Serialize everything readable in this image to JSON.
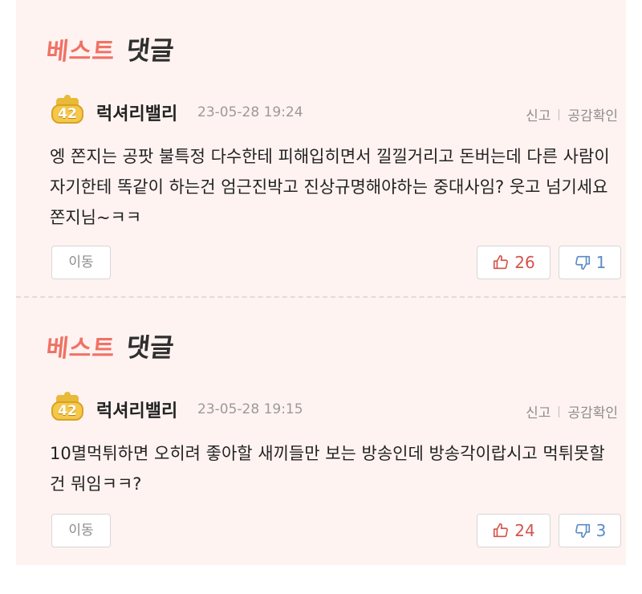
{
  "comments": [
    {
      "badge_red": "베스트",
      "badge_dark": "댓글",
      "level": "42",
      "username": "럭셔리밸리",
      "date": "23-05-28 19:24",
      "report": "신고",
      "agree_check": "공감확인",
      "text": "엥 쫀지는 공팟 불특정 다수한테 피해입히면서 낄낄거리고 돈버는데 다른 사람이 자기한테 똑같이 하는건 엄근진박고 진상규명해야하는 중대사임? 웃고 넘기세요 쫀지님~ㅋㅋ",
      "move_label": "이동",
      "likes": "26",
      "dislikes": "1"
    },
    {
      "badge_red": "베스트",
      "badge_dark": "댓글",
      "level": "42",
      "username": "럭셔리밸리",
      "date": "23-05-28 19:15",
      "report": "신고",
      "agree_check": "공감확인",
      "text": "10멸먹튀하면 오히려 좋아할 새끼들만 보는 방송인데 방송각이랍시고 먹튀못할건 뭐임ㅋㅋ?",
      "move_label": "이동",
      "likes": "24",
      "dislikes": "3"
    }
  ],
  "colors": {
    "background": "#fff3f1",
    "badge_red": "#f07266",
    "like": "#d4544c",
    "dislike": "#5b8bc6"
  }
}
